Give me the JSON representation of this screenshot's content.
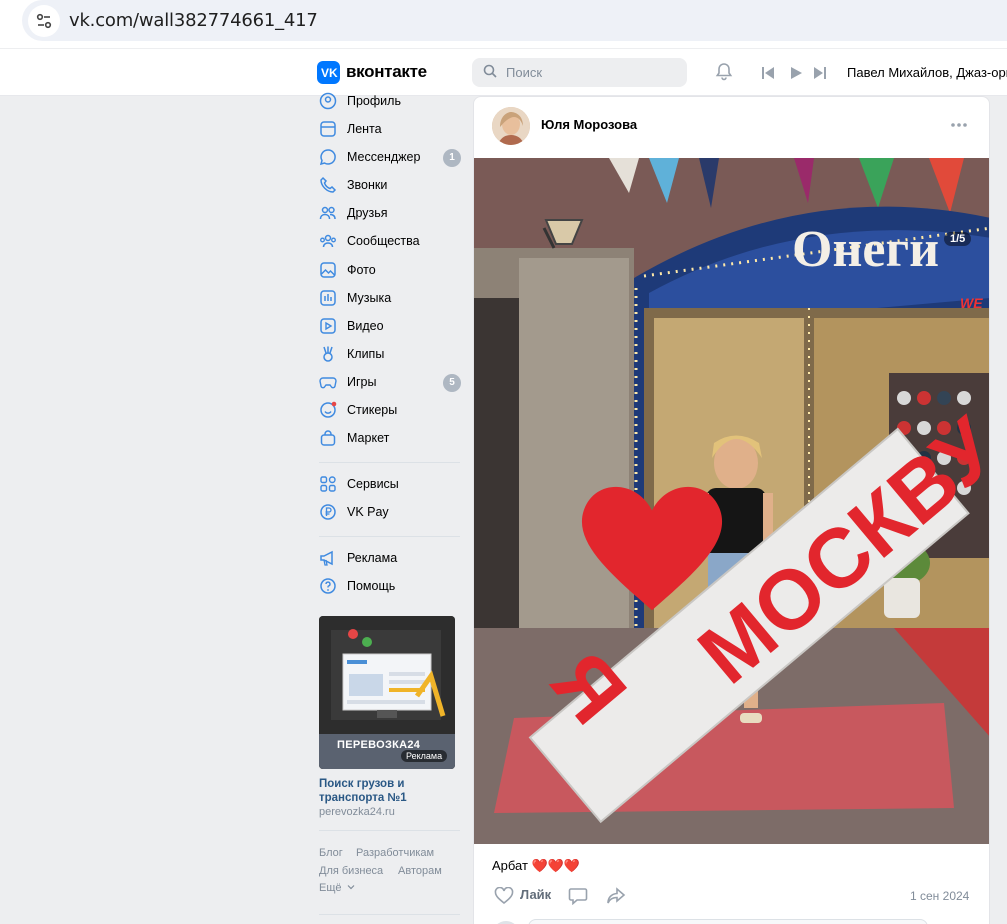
{
  "browser": {
    "url": "vk.com/wall382774661_417"
  },
  "header": {
    "logo_text": "вконтакте",
    "search_placeholder": "Поиск",
    "now_playing": "Павел Михайлов, Джаз-орк"
  },
  "sidebar": {
    "items": [
      {
        "label": "Профиль",
        "icon": "profile-icon"
      },
      {
        "label": "Лента",
        "icon": "feed-icon"
      },
      {
        "label": "Мессенджер",
        "icon": "messenger-icon",
        "badge": "1"
      },
      {
        "label": "Звонки",
        "icon": "phone-icon"
      },
      {
        "label": "Друзья",
        "icon": "friends-icon"
      },
      {
        "label": "Сообщества",
        "icon": "communities-icon"
      },
      {
        "label": "Фото",
        "icon": "photo-icon"
      },
      {
        "label": "Музыка",
        "icon": "music-icon"
      },
      {
        "label": "Видео",
        "icon": "video-icon"
      },
      {
        "label": "Клипы",
        "icon": "clips-icon"
      },
      {
        "label": "Игры",
        "icon": "games-icon",
        "badge": "5"
      },
      {
        "label": "Стикеры",
        "icon": "stickers-icon"
      },
      {
        "label": "Маркет",
        "icon": "market-icon"
      }
    ],
    "items2": [
      {
        "label": "Сервисы",
        "icon": "services-icon"
      },
      {
        "label": "VK Pay",
        "icon": "vkpay-icon"
      }
    ],
    "items3": [
      {
        "label": "Реклама",
        "icon": "ads-icon"
      },
      {
        "label": "Помощь",
        "icon": "help-icon"
      }
    ],
    "ad": {
      "brand": "ПЕРЕВОЗКА24",
      "tag": "Реклама",
      "title": "Поиск грузов и транспорта №1",
      "url": "perevozka24.ru"
    },
    "footer": {
      "blog": "Блог",
      "developers": "Разработчикам",
      "business": "Для бизнеса",
      "authors": "Авторам",
      "more": "Ещё"
    }
  },
  "post": {
    "author": "Юля Морозова",
    "photo_counter": "1/5",
    "photo_sign_text": "Онеги",
    "sign_we": "WE",
    "sign_love": "Я",
    "sign_city": "МОСКВУ",
    "caption": "Арбат ❤️❤️❤️",
    "like_label": "Лайк",
    "date": "1 сен 2024"
  },
  "colors": {
    "accent": "#0077ff",
    "link": "#2a5885",
    "muted": "#818c99",
    "badge": "#aeb7c2"
  }
}
